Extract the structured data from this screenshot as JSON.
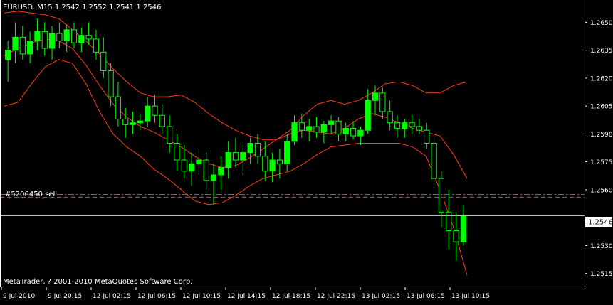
{
  "header": {
    "title": "EURUSD.,M15  1.2542 1.2552 1.2541 1.2546"
  },
  "order_label": "#5206450 sell",
  "copyright": "MetaTrader, ? 2001-2010 MetaQuotes Software Corp.",
  "colors": {
    "background": "#000000",
    "frame": "#ffffff",
    "bull_candle": "#00ff00",
    "bands": "#ff3b1a",
    "order_line_green": "#00b000",
    "order_line_red": "#ff3b1a",
    "bid_line": "#b8b8c8"
  },
  "chart_data": {
    "type": "candlestick",
    "symbol": "EURUSD.",
    "timeframe": "M15",
    "ohlc_current": {
      "open": 1.2542,
      "high": 1.2552,
      "low": 1.2541,
      "close": 1.2546
    },
    "current_price_label": "1.2546",
    "ylim": [
      1.2508,
      1.2662
    ],
    "ytick_labels": [
      "1.2650",
      "1.2635",
      "1.2620",
      "1.2605",
      "1.2590",
      "1.2575",
      "1.2560",
      "1.2530",
      "1.2515"
    ],
    "xtick_labels": [
      "9 Jul 2010",
      "9 Jul 20:15",
      "12 Jul 02:15",
      "12 Jul 06:15",
      "12 Jul 10:15",
      "12 Jul 14:15",
      "12 Jul 18:15",
      "12 Jul 22:15",
      "13 Jul 02:15",
      "13 Jul 06:15",
      "13 Jul 10:15"
    ],
    "order_line": {
      "label": "#5206450 sell",
      "open_price": 1.25575,
      "stop_price": 1.2556
    },
    "bid_line": 1.2546,
    "candles": [
      [
        1.263,
        1.264,
        1.2618,
        1.2635
      ],
      [
        1.2635,
        1.265,
        1.2628,
        1.2642
      ],
      [
        1.2642,
        1.2648,
        1.263,
        1.2633
      ],
      [
        1.2633,
        1.2645,
        1.2628,
        1.264
      ],
      [
        1.264,
        1.2652,
        1.2635,
        1.2645
      ],
      [
        1.2645,
        1.265,
        1.2632,
        1.2636
      ],
      [
        1.2636,
        1.2648,
        1.263,
        1.2644
      ],
      [
        1.2644,
        1.265,
        1.2636,
        1.264
      ],
      [
        1.264,
        1.2649,
        1.2634,
        1.2646
      ],
      [
        1.2646,
        1.265,
        1.2636,
        1.2639
      ],
      [
        1.2639,
        1.2647,
        1.2634,
        1.2643
      ],
      [
        1.2643,
        1.265,
        1.2638,
        1.2641
      ],
      [
        1.2641,
        1.2646,
        1.263,
        1.2634
      ],
      [
        1.2634,
        1.2642,
        1.262,
        1.2624
      ],
      [
        1.2624,
        1.2628,
        1.2605,
        1.261
      ],
      [
        1.261,
        1.2618,
        1.2594,
        1.2598
      ],
      [
        1.2598,
        1.2604,
        1.2588,
        1.2595
      ],
      [
        1.2595,
        1.2602,
        1.259,
        1.2596
      ],
      [
        1.2596,
        1.2601,
        1.2592,
        1.2597
      ],
      [
        1.2597,
        1.261,
        1.2594,
        1.2605
      ],
      [
        1.2605,
        1.2611,
        1.2596,
        1.26
      ],
      [
        1.26,
        1.2606,
        1.259,
        1.2594
      ],
      [
        1.2594,
        1.26,
        1.258,
        1.2585
      ],
      [
        1.2585,
        1.259,
        1.257,
        1.2576
      ],
      [
        1.2576,
        1.2584,
        1.2566,
        1.257
      ],
      [
        1.257,
        1.258,
        1.2562,
        1.2574
      ],
      [
        1.2574,
        1.2582,
        1.2568,
        1.2576
      ],
      [
        1.2576,
        1.258,
        1.256,
        1.2565
      ],
      [
        1.2565,
        1.2574,
        1.2552,
        1.2568
      ],
      [
        1.2568,
        1.2578,
        1.256,
        1.2572
      ],
      [
        1.2572,
        1.2586,
        1.2566,
        1.258
      ],
      [
        1.258,
        1.2588,
        1.2572,
        1.2576
      ],
      [
        1.2576,
        1.2584,
        1.2568,
        1.258
      ],
      [
        1.258,
        1.2588,
        1.2574,
        1.2585
      ],
      [
        1.2585,
        1.259,
        1.2574,
        1.2578
      ],
      [
        1.2578,
        1.2586,
        1.2565,
        1.257
      ],
      [
        1.257,
        1.258,
        1.2564,
        1.2576
      ],
      [
        1.2576,
        1.2582,
        1.2566,
        1.2574
      ],
      [
        1.2574,
        1.259,
        1.257,
        1.2586
      ],
      [
        1.2586,
        1.26,
        1.2584,
        1.2596
      ],
      [
        1.2596,
        1.2601,
        1.2588,
        1.2592
      ],
      [
        1.2592,
        1.2598,
        1.2586,
        1.2594
      ],
      [
        1.2594,
        1.2599,
        1.2588,
        1.2591
      ],
      [
        1.2591,
        1.2597,
        1.2585,
        1.2595
      ],
      [
        1.2595,
        1.26,
        1.259,
        1.2597
      ],
      [
        1.2597,
        1.2599,
        1.2586,
        1.259
      ],
      [
        1.259,
        1.2596,
        1.2586,
        1.2593
      ],
      [
        1.2593,
        1.2597,
        1.2587,
        1.2589
      ],
      [
        1.2589,
        1.2594,
        1.2584,
        1.2592
      ],
      [
        1.2592,
        1.2614,
        1.259,
        1.2608
      ],
      [
        1.2608,
        1.2616,
        1.26,
        1.2612
      ],
      [
        1.2612,
        1.2615,
        1.2598,
        1.2602
      ],
      [
        1.2602,
        1.2608,
        1.2592,
        1.2596
      ],
      [
        1.2596,
        1.26,
        1.2588,
        1.2593
      ],
      [
        1.2593,
        1.2598,
        1.2588,
        1.2596
      ],
      [
        1.2596,
        1.26,
        1.259,
        1.2594
      ],
      [
        1.2594,
        1.2598,
        1.259,
        1.2592
      ],
      [
        1.2592,
        1.2596,
        1.2582,
        1.2585
      ],
      [
        1.2585,
        1.259,
        1.2562,
        1.2566
      ],
      [
        1.2566,
        1.257,
        1.254,
        1.2548
      ],
      [
        1.2548,
        1.256,
        1.2528,
        1.2538
      ],
      [
        1.2538,
        1.2548,
        1.2522,
        1.2532
      ],
      [
        1.2532,
        1.2552,
        1.253,
        1.2546
      ]
    ],
    "bollinger_bands": {
      "upper": [
        1.2655,
        1.2656,
        1.2655,
        1.2654,
        1.2652,
        1.2646,
        1.264,
        1.2633,
        1.2625,
        1.2618,
        1.2612,
        1.261,
        1.261,
        1.2611,
        1.2607,
        1.2601,
        1.2596,
        1.2592,
        1.2589,
        1.2587,
        1.2587,
        1.2592,
        1.26,
        1.2606,
        1.2608,
        1.2606,
        1.2608,
        1.2612,
        1.2617,
        1.2618,
        1.2616,
        1.2612,
        1.2612,
        1.2616,
        1.2618
      ],
      "middle": [
        1.2632,
        1.2636,
        1.2639,
        1.2641,
        1.264,
        1.2636,
        1.2627,
        1.2616,
        1.2606,
        1.2599,
        1.2594,
        1.2591,
        1.2587,
        1.2583,
        1.2578,
        1.2574,
        1.2572,
        1.2573,
        1.2577,
        1.2582,
        1.2587,
        1.259,
        1.2592,
        1.2591,
        1.259,
        1.2593,
        1.2598,
        1.2601,
        1.2599,
        1.2596,
        1.2593,
        1.2591,
        1.2589,
        1.2579,
        1.2566
      ],
      "lower": [
        1.2605,
        1.2607,
        1.2617,
        1.2626,
        1.263,
        1.2628,
        1.2617,
        1.2602,
        1.259,
        1.2583,
        1.2578,
        1.2571,
        1.2566,
        1.256,
        1.2554,
        1.2552,
        1.2553,
        1.2557,
        1.2562,
        1.2566,
        1.2568,
        1.257,
        1.2574,
        1.2579,
        1.2583,
        1.2584,
        1.2585,
        1.2585,
        1.2585,
        1.2585,
        1.2583,
        1.2578,
        1.256,
        1.254,
        1.2514
      ]
    }
  }
}
